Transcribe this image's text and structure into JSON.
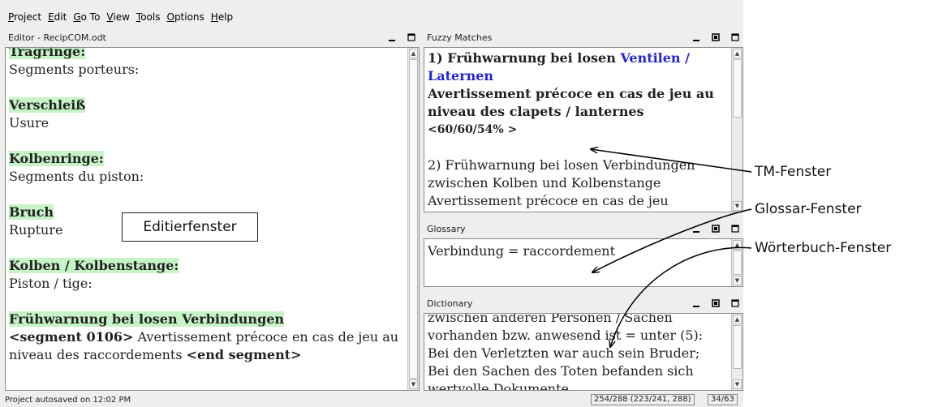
{
  "menu": [
    "Project",
    "Edit",
    "Go To",
    "View",
    "Tools",
    "Options",
    "Help"
  ],
  "editor": {
    "title": "Editor - RecipCOM.odt",
    "lines": [
      {
        "text": "Tragringe:",
        "style": "hl"
      },
      {
        "text": "Segments porteurs:",
        "style": ""
      },
      {
        "text": "",
        "style": ""
      },
      {
        "text": "Verschleiß",
        "style": "hl"
      },
      {
        "text": "Usure",
        "style": ""
      },
      {
        "text": "",
        "style": ""
      },
      {
        "text": "Kolbenringe:",
        "style": "hl"
      },
      {
        "text": "Segments du piston:",
        "style": ""
      },
      {
        "text": "",
        "style": ""
      },
      {
        "text": "Bruch",
        "style": "hl"
      },
      {
        "text": "Rupture",
        "style": ""
      },
      {
        "text": "",
        "style": ""
      },
      {
        "text": "Kolben / Kolbenstange:",
        "style": "hl"
      },
      {
        "text": "Piston / tige:",
        "style": ""
      },
      {
        "text": "",
        "style": ""
      },
      {
        "text": "Frühwarnung bei losen Verbindungen",
        "style": "hl"
      }
    ],
    "segment": {
      "open_tag": "<segment 0106>",
      "text_1": " Avertissement précoce en cas de jeu au",
      "text_2": "niveau des raccordements ",
      "close_tag": "<end segment>"
    }
  },
  "fuzzy": {
    "title": "Fuzzy Matches",
    "m1_src_1": "1) Frühwarnung bei losen ",
    "m1_src_1_diff": "Ventilen /",
    "m1_src_2_diff": "Laternen",
    "m1_tgt_1": "Avertissement précoce en cas de jeu au",
    "m1_tgt_2": "niveau des clapets / lanternes",
    "m1_score": "<60/60/54% >",
    "m2_line_1": "2) Frühwarnung bei losen Verbindungen",
    "m2_line_2": "zwischen Kolben und Kolbenstange",
    "m2_line_3": "Avertissement précoce en cas de jeu"
  },
  "glossary": {
    "title": "Glossary",
    "entry": "Verbindung = raccordement"
  },
  "dictionary": {
    "title": "Dictionary",
    "lines": [
      "zwischen anderen Personen / Sachen",
      "vorhanden bzw. anwesend ist = unter (5):",
      "Bei den Verletzten war auch sein Bruder;",
      "Bei den Sachen des Toten befanden sich",
      "wertvolle Dokumente."
    ]
  },
  "status": {
    "left": "Project autosaved on 12:02 PM",
    "progress": "254/288 (223/241, 288)",
    "position": "34/63"
  },
  "annotations": {
    "editor_label": "Editierfenster",
    "tm": "TM-Fenster",
    "glossary": "Glossar-Fenster",
    "dictionary": "Wörterbuch-Fenster"
  }
}
